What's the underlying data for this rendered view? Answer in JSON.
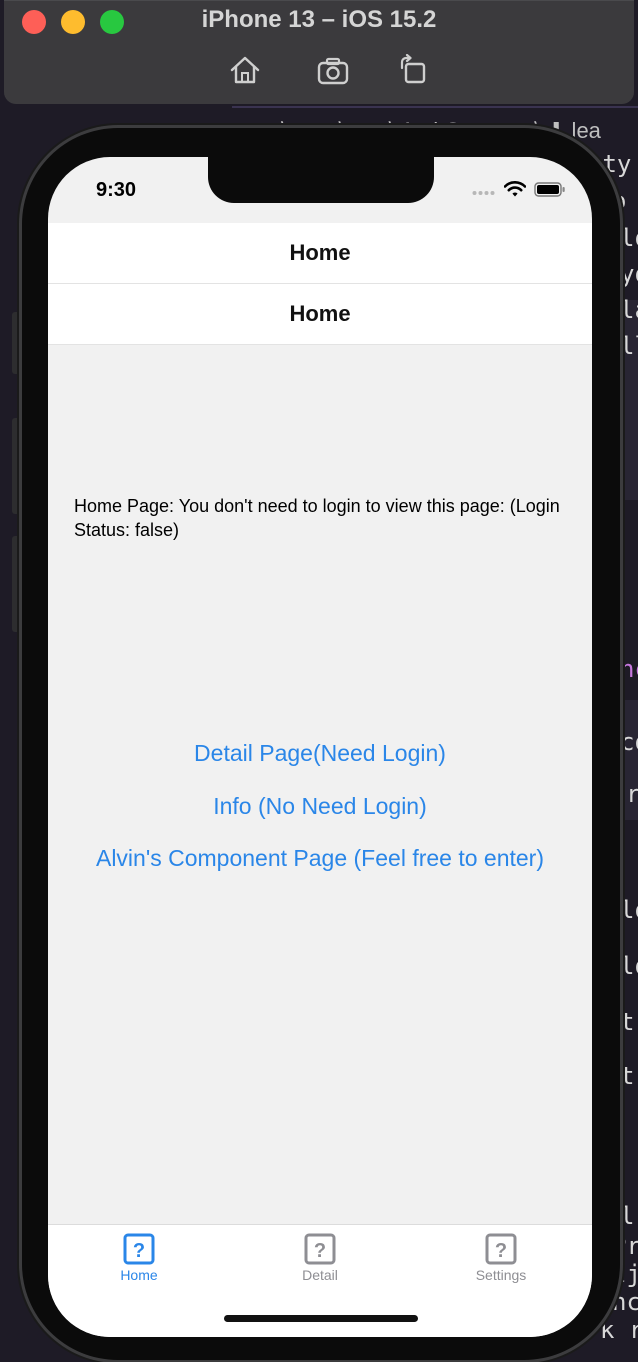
{
  "simulator": {
    "title": "iPhone 13 – iOS 15.2",
    "tools": [
      "home-icon",
      "screenshot-icon",
      "rotate-icon"
    ]
  },
  "background_editor": {
    "breadcrumb": "…s ⟩ app ⟩ src ⟩ AuthScreens ⟩ ⬇ lea",
    "fragments": [
      "sty",
      "o",
      "lo",
      "yo",
      "la",
      "ll",
      "nc",
      "co",
      "r",
      "lo",
      "lo",
      "t",
      "t",
      "l",
      "Pr",
      "tj",
      "nc",
      "k r"
    ]
  },
  "status_bar": {
    "time": "9:30",
    "icons": [
      "cellular-icon",
      "wifi-icon",
      "battery-icon"
    ]
  },
  "headers": {
    "outer_title": "Home",
    "inner_title": "Home"
  },
  "home": {
    "intro": "Home Page: You don't need to login to view this page: (Login Status: false)",
    "links": {
      "detail": "Detail Page(Need Login)",
      "info": "Info (No Need Login)",
      "component": "Alvin's Component Page (Feel free to enter)"
    }
  },
  "tabbar": {
    "tabs": [
      {
        "label": "Home",
        "icon": "question-icon",
        "active": true
      },
      {
        "label": "Detail",
        "icon": "question-icon",
        "active": false
      },
      {
        "label": "Settings",
        "icon": "question-icon",
        "active": false
      }
    ]
  },
  "colors": {
    "link": "#2a86e8",
    "screen_bg": "#f1f1f1",
    "header_bg": "#ffffff",
    "inactive_tab": "#8e8e93"
  }
}
